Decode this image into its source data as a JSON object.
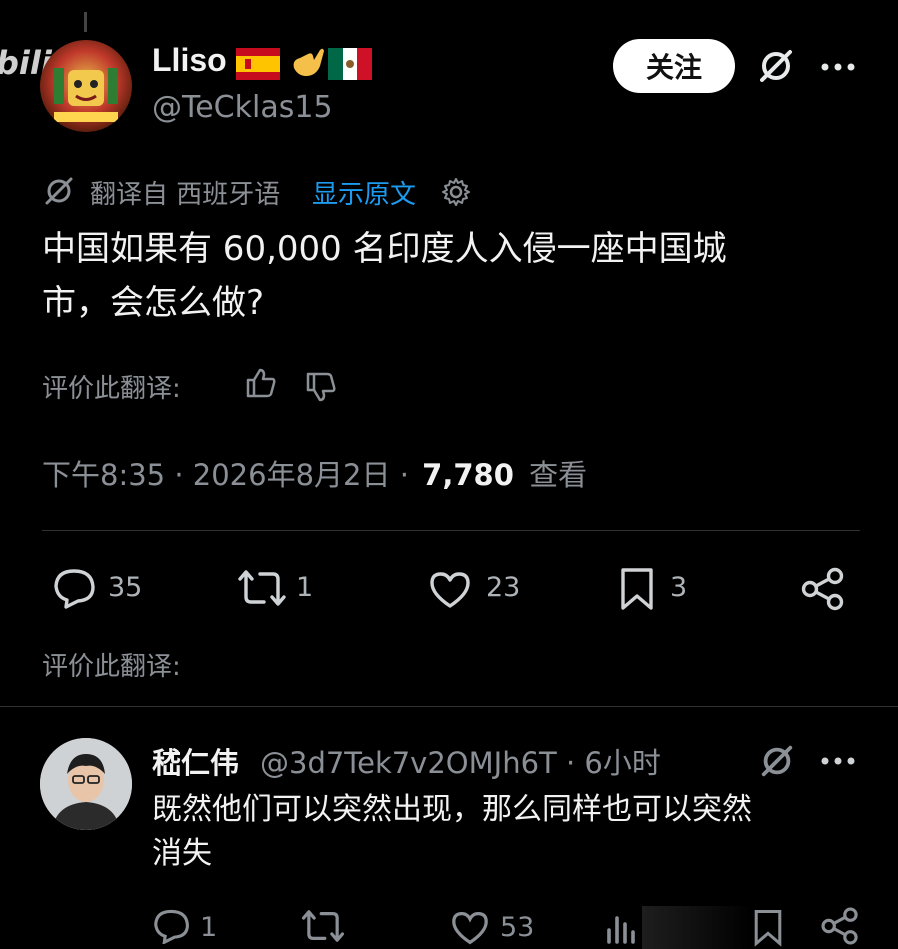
{
  "watermark": "bili",
  "author": {
    "name": "Lliso",
    "handle": "@TeCklas15"
  },
  "follow_label": "关注",
  "translation": {
    "from_label": "翻译自 西班牙语",
    "show_original": "显示原文"
  },
  "tweet_text_line1": "中国如果有 60,000 名印度人入侵一座中国城",
  "tweet_text_line2": "市，会怎么做?",
  "rate_translation_label": "评价此翻译:",
  "meta": {
    "time_date": "下午8:35 · 2026年8月2日 ·",
    "views": "7,780",
    "views_label": "查看"
  },
  "stats": {
    "replies": "35",
    "reposts": "1",
    "likes": "23",
    "bookmarks": "3"
  },
  "rate_translation_label_2": "评价此翻译:",
  "reply": {
    "name": "嵇仁伟",
    "handle_time": "@3d7Tek7v2OMJh6T · 6小时",
    "text_line1": "既然他们可以突然出现，那么同样也可以突然",
    "text_line2": "消失",
    "stats": {
      "replies": "1",
      "likes": "53"
    }
  },
  "colors": {
    "background": "#000000",
    "link": "#1d9bf0",
    "muted": "#8b9096"
  }
}
